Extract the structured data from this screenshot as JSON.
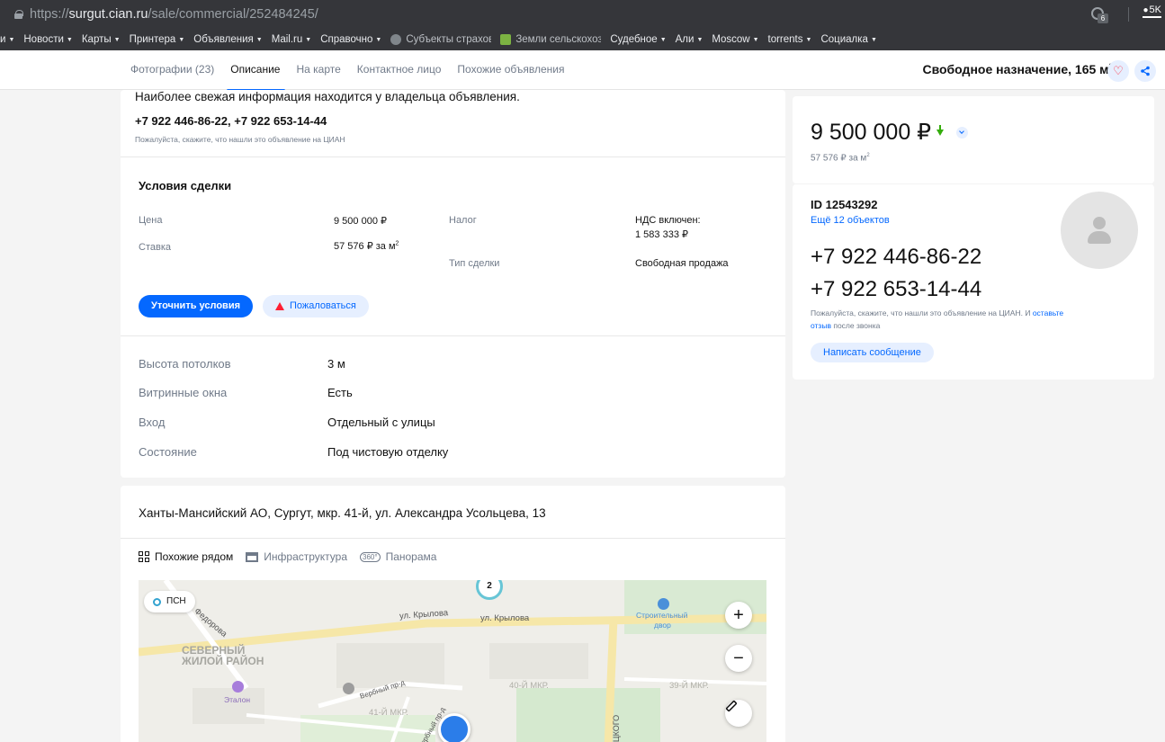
{
  "browser": {
    "url_prefix": "https://",
    "url_host": "surgut.cian.ru",
    "url_path": "/sale/commercial/252484245/",
    "extension_badge": "6",
    "notification_count": "5K",
    "bookmarks": [
      {
        "label": "и",
        "has_menu": true
      },
      {
        "label": "Новости",
        "has_menu": true
      },
      {
        "label": "Карты",
        "has_menu": true
      },
      {
        "label": "Принтера",
        "has_menu": true
      },
      {
        "label": "Объявления",
        "has_menu": true
      },
      {
        "label": "Mail.ru",
        "has_menu": true
      },
      {
        "label": "Справочно",
        "has_menu": true
      },
      {
        "label": "Субъекты страхов",
        "has_menu": false
      },
      {
        "label": "Земли сельскохоз",
        "has_menu": false
      },
      {
        "label": "Судебное",
        "has_menu": true
      },
      {
        "label": "Али",
        "has_menu": true
      },
      {
        "label": "Moscow",
        "has_menu": true
      },
      {
        "label": "torrents",
        "has_menu": true
      },
      {
        "label": "Социалка",
        "has_menu": true
      }
    ]
  },
  "nav": {
    "tabs": [
      "Фотографии (23)",
      "Описание",
      "На карте",
      "Контактное лицо",
      "Похожие объявления"
    ],
    "active_tab": "Описание",
    "summary": "Свободное назначение, 165 м",
    "summary_sup": "2"
  },
  "contact": {
    "note": "Наиболее свежая информация находится у владельца объявления.",
    "phones": "+7 922 446-86-22, +7 922 653-14-44",
    "hint": "Пожалуйста, скажите, что нашли это объявление на ЦИАН"
  },
  "deal": {
    "title": "Условия сделки",
    "price_label": "Цена",
    "price_value": "9 500 000 ₽",
    "rate_label": "Ставка",
    "rate_value": "57 576 ₽ за м",
    "rate_sup": "2",
    "tax_label": "Налог",
    "tax_value_1": "НДС включен:",
    "tax_value_2": "1 583 333 ₽",
    "deal_type_label": "Тип сделки",
    "deal_type_value": "Свободная продажа",
    "clarify_button": "Уточнить условия",
    "complain_button": "Пожаловаться"
  },
  "params": [
    {
      "label": "Высота потолков",
      "value": "3 м"
    },
    {
      "label": "Витринные окна",
      "value": "Есть"
    },
    {
      "label": "Вход",
      "value": "Отдельный с улицы"
    },
    {
      "label": "Состояние",
      "value": "Под чистовую отделку"
    }
  ],
  "location": {
    "address": "Ханты-Мансийский АО, Сургут, мкр. 41-й, ул. Александра Усольцева, 13",
    "tabs": [
      "Похожие рядом",
      "Инфраструктура",
      "Панорама"
    ],
    "pano_badge": "360°",
    "filter_chip": "ПСН",
    "cluster_count": "2",
    "labels": {
      "street1": "ул. Крылова",
      "street2": "ул. Крылова",
      "street3": "Федорова",
      "district_1": "СЕВЕРНЫЙ",
      "district_2": "ЖИЛОЙ РАЙОН",
      "poi1": "Эталон",
      "poi2": "Строительный",
      "poi2b": "двор",
      "area1": "40-Й МКР.",
      "area2": "39-Й МКР.",
      "area3": "41-Й МКР.",
      "road1": "Вербный пр-д",
      "road2": "Вербный пр-д",
      "road3": "ЦКОГО"
    }
  },
  "offer": {
    "price": "9 500 000 ₽",
    "price_per_m": "57 576 ₽ за м",
    "price_per_m_sup": "2",
    "seller_id": "ID 12543292",
    "more_objects": "Ещё 12 объектов",
    "phone1": "+7 922 446-86-22",
    "phone2": "+7 922 653-14-44",
    "call_note_1": "Пожалуйста, скажите, что нашли это объявление на ЦИАН. И",
    "call_note_link": "оставьте отзыв",
    "call_note_2": "после звонка",
    "message_button": "Написать сообщение"
  },
  "colors": {
    "accent": "#0468ff",
    "accent_soft": "#e6efff",
    "danger": "#ff1f34",
    "price_down": "#34ac0a"
  }
}
